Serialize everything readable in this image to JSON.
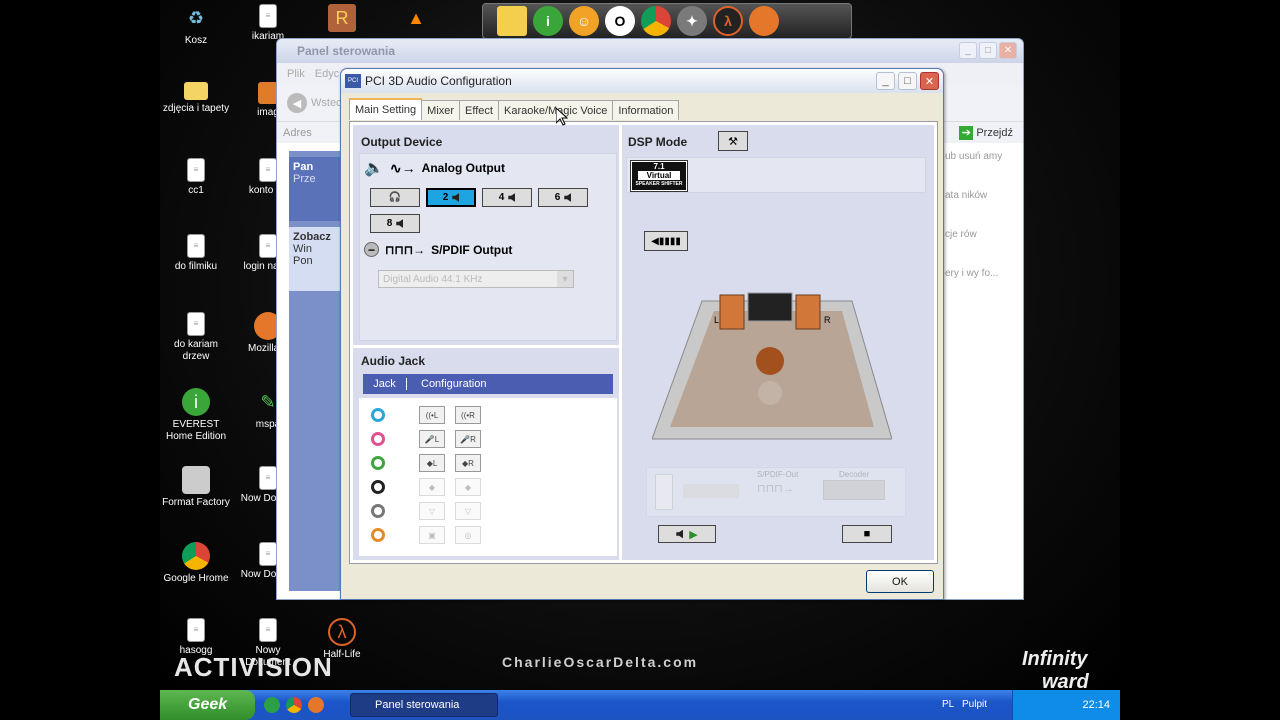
{
  "desktop": {
    "icons": [
      {
        "label": "Kosz",
        "x": 0
      },
      {
        "label": "ikariam"
      },
      {
        "label": "zdjęcia i tapety"
      },
      {
        "label": "imag"
      },
      {
        "label": "cc1"
      },
      {
        "label": "konto rol"
      },
      {
        "label": "do filmiku"
      },
      {
        "label": "login na bo"
      },
      {
        "label": "do kariam drzew"
      },
      {
        "label": "Mozilla F"
      },
      {
        "label": "EVEREST Home Edition"
      },
      {
        "label": "mspa"
      },
      {
        "label": "Format Factory"
      },
      {
        "label": "Now Dokum"
      },
      {
        "label": "Google Hrome"
      },
      {
        "label": "Now Dokum"
      },
      {
        "label": "hasogg"
      },
      {
        "label": "Nowy Dokument"
      },
      {
        "label": "Half-Life"
      }
    ],
    "watermarks": {
      "activision": "ACTIVISION",
      "site": "CharlieOscarDelta.com",
      "iw_a": "Infinity",
      "iw_b": "ward"
    }
  },
  "control_panel": {
    "title": "Panel sterowania",
    "menu": [
      "Plik",
      "Edyc"
    ],
    "back": "Wstec",
    "address_label": "Adres",
    "go": "Przejdź",
    "left_panel_title": "Pan",
    "left_link": "Prze",
    "see_also": "Zobacz",
    "links": [
      "Win",
      "Pon"
    ],
    "right_items": [
      "ub usuń amy",
      "ata ników",
      "cje rów",
      "ery i wy fo..."
    ]
  },
  "dialog": {
    "title": "PCI 3D Audio Configuration",
    "tabs": [
      "Main Setting",
      "Mixer",
      "Effect",
      "Karaoke/Magic Voice",
      "Information"
    ],
    "output_device": "Output Device",
    "analog_output": "Analog Output",
    "channel_buttons": [
      "2",
      "4",
      "6",
      "8"
    ],
    "spdif_output": "S/PDIF Output",
    "spdif_select": "Digital Audio 44.1 KHz",
    "audio_jack": "Audio Jack",
    "jack_col": "Jack",
    "config_col": "Configuration",
    "jacks": [
      {
        "color": "#2aa6d8"
      },
      {
        "color": "#e0518f"
      },
      {
        "color": "#3fa63f"
      },
      {
        "color": "#222222"
      },
      {
        "color": "#777777"
      },
      {
        "color": "#e58a2b"
      }
    ],
    "dsp_mode": "DSP Mode",
    "virtual_top": "7.1",
    "virtual_mid": "Virtual",
    "virtual_bot": "SPEAKER SHIFTER",
    "room_l": "L",
    "room_r": "R",
    "spdif_out": "S/PDIF-Out",
    "decoder": "Decoder",
    "ok": "OK"
  },
  "taskbar": {
    "start": "Geek",
    "app": "Panel sterowania",
    "lang": "PL",
    "desktop": "Pulpit",
    "time": "22:14"
  }
}
